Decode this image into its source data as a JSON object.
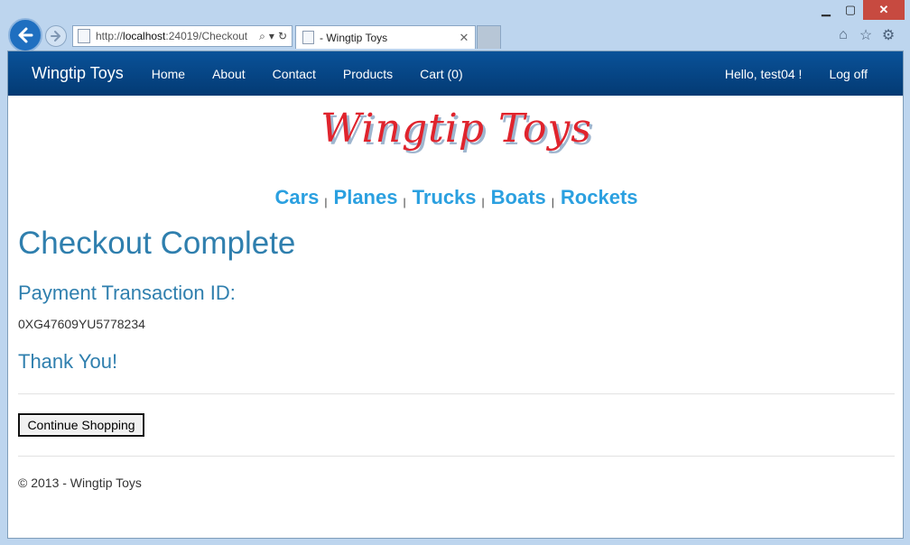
{
  "browser": {
    "url_prefix": "http://",
    "url_host": "localhost",
    "url_rest": ":24019/Checkout",
    "tab_title": "- Wingtip Toys",
    "tab_close": "✕",
    "win_min": "▁",
    "win_max": "▢",
    "win_close": "✕"
  },
  "navbar": {
    "brand": "Wingtip Toys",
    "links": [
      "Home",
      "About",
      "Contact",
      "Products",
      "Cart (0)"
    ],
    "greeting": "Hello, test04 !",
    "logoff": "Log off"
  },
  "logo": {
    "text": "Wingtip Toys"
  },
  "categories": [
    "Cars",
    "Planes",
    "Trucks",
    "Boats",
    "Rockets"
  ],
  "category_separator": "|",
  "main": {
    "title": "Checkout Complete",
    "payment_label": "Payment Transaction ID:",
    "transaction_id": "0XG47609YU5778234",
    "thanks": "Thank You!",
    "continue_label": "Continue Shopping"
  },
  "footer": {
    "text": "© 2013 - Wingtip Toys"
  },
  "colors": {
    "navbar": "#0a5299",
    "heading": "#2f7fae",
    "category_link": "#2ba0e0",
    "logo": "#e0242d"
  }
}
